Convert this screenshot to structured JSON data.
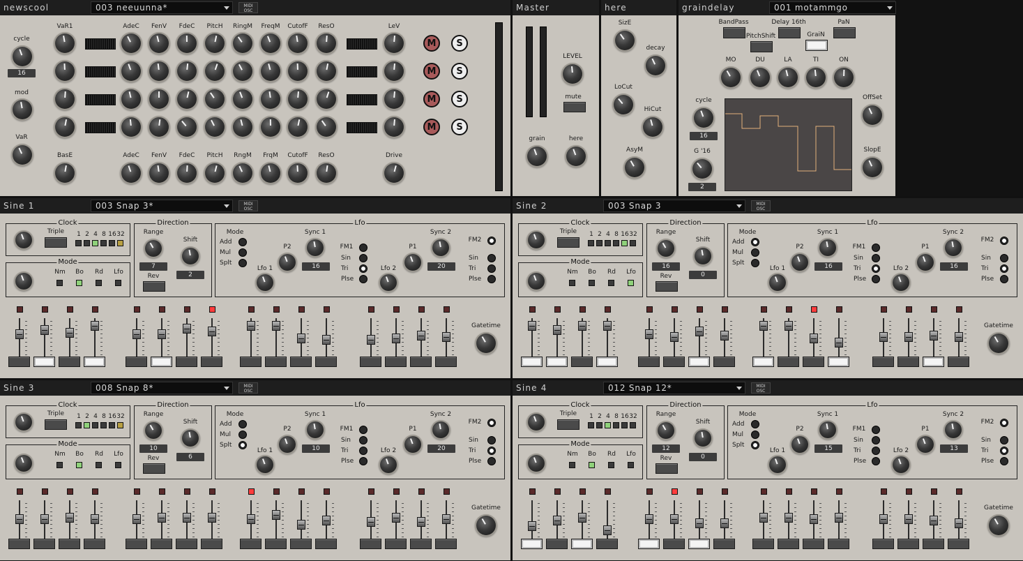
{
  "top": {
    "newscool": {
      "title": "newscool",
      "preset": "003  neeuunna*",
      "midi": [
        "MIDI",
        "OSC"
      ],
      "left": {
        "cycle_label": "cycle",
        "cycle_value": "16",
        "mod_label": "mod",
        "var_label": "VaR"
      },
      "col_labels_top": [
        "VaR1",
        "AdeC",
        "FenV",
        "FdeC",
        "PitcH",
        "RingM",
        "FreqM",
        "CutofF",
        "ResO",
        "LeV"
      ],
      "col_labels_bottom": [
        "BasE",
        "AdeC",
        "FenV",
        "FdeC",
        "PitcH",
        "RngM",
        "FrqM",
        "CutofF",
        "ResO",
        "Drive"
      ],
      "mute_label": "M",
      "solo_label": "S"
    },
    "master": {
      "title": "Master",
      "level_label": "LEVEL",
      "mute_label": "mute",
      "grain_label": "grain",
      "here_label": "here"
    },
    "here": {
      "title": "here",
      "size_label": "SizE",
      "decay_label": "decay",
      "locut_label": "LoCut",
      "hicut_label": "HiCut",
      "asym_label": "AsyM"
    },
    "graindelay": {
      "title": "graindelay",
      "preset": "001  motammgo",
      "bandpass": "BandPass",
      "delay16": "Delay 16th",
      "pan": "PaN",
      "pitchshift": "PitchShift",
      "grain": "GraiN",
      "knob_labels": [
        "MO",
        "DU",
        "LA",
        "TI",
        "ON"
      ],
      "cycle_label": "cycle",
      "cycle_value": "16",
      "g16_label": "G '16",
      "g16_value": "2",
      "offset_label": "OffSet",
      "slope_label": "SlopE"
    }
  },
  "sines": [
    {
      "title": "Sine 1",
      "preset": "003   Snap 3*",
      "range": "7",
      "shift": "2",
      "sync1": "16",
      "sync2": "20"
    },
    {
      "title": "Sine  2",
      "preset": "003   Snap 3",
      "range": "16",
      "shift": "0",
      "sync1": "16",
      "sync2": "16"
    },
    {
      "title": "Sine  3",
      "preset": "008   Snap 8*",
      "range": "10",
      "shift": "6",
      "sync1": "10",
      "sync2": "20"
    },
    {
      "title": "Sine  4",
      "preset": "012   Snap 12*",
      "range": "12",
      "shift": "0",
      "sync1": "15",
      "sync2": "13"
    }
  ],
  "sine_common": {
    "midi": [
      "MIDI",
      "OSC"
    ],
    "clock": "Clock",
    "triple": "Triple",
    "clock_divs": [
      "1",
      "2",
      "4",
      "8",
      "16",
      "32"
    ],
    "mode": "Mode",
    "modes": [
      "Nm",
      "Bo",
      "Rd",
      "Lfo"
    ],
    "direction": "Direction",
    "range": "Range",
    "shift": "Shift",
    "rev": "Rev",
    "lfo": "Lfo",
    "lfo_mode": "Mode",
    "lfo_modes": [
      "Add",
      "Mul",
      "Splt"
    ],
    "lfo1": "Lfo 1",
    "lfo2": "Lfo 2",
    "p2": "P2",
    "p1": "P1",
    "sync1": "Sync 1",
    "sync2": "Sync 2",
    "fm1": "FM1",
    "fm2": "FM2",
    "waves": [
      "Sin",
      "Tri",
      "Plse"
    ],
    "gatetime": "Gatetime"
  }
}
